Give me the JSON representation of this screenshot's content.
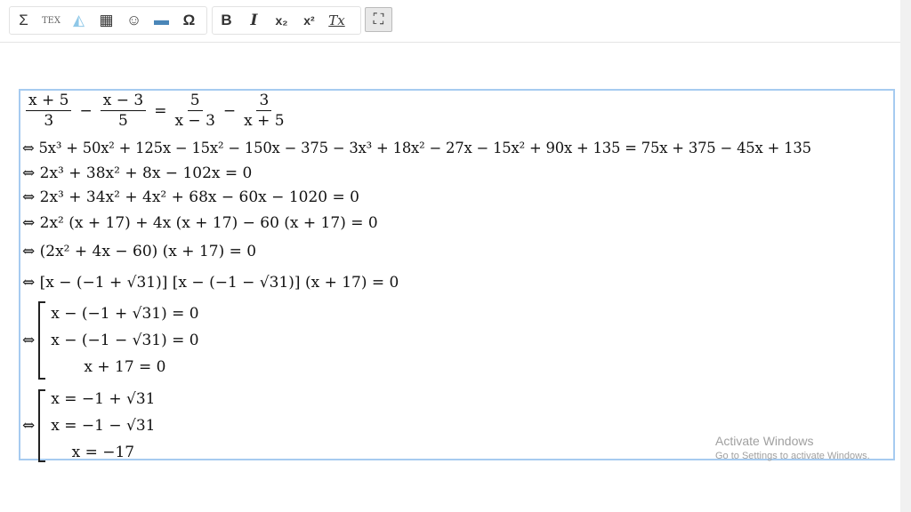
{
  "toolbar": {
    "group1": [
      {
        "name": "sigma-icon",
        "glyph": "Σ"
      },
      {
        "name": "tex-icon",
        "glyph": "TEX"
      },
      {
        "name": "shape-icon",
        "glyph": "◭"
      },
      {
        "name": "table-icon",
        "glyph": "▦"
      },
      {
        "name": "smiley-icon",
        "glyph": "☺"
      },
      {
        "name": "image-icon",
        "glyph": "▬"
      },
      {
        "name": "omega-icon",
        "glyph": "Ω"
      }
    ],
    "group2": [
      {
        "name": "bold-icon",
        "glyph": "B"
      },
      {
        "name": "italic-icon",
        "glyph": "I"
      },
      {
        "name": "subscript-icon",
        "glyph": "x₂"
      },
      {
        "name": "superscript-icon",
        "glyph": "x²"
      },
      {
        "name": "remove-format-icon",
        "glyph": "Tx"
      }
    ],
    "maximize": {
      "name": "maximize-icon",
      "glyph": "⛶",
      "active": true
    }
  },
  "math": {
    "line1": {
      "f1n": "x + 5",
      "f1d": "3",
      "op1": "−",
      "f2n": "x − 3",
      "f2d": "5",
      "eq": "=",
      "f3n": "5",
      "f3d": "x − 3",
      "op2": "−",
      "f4n": "3",
      "f4d": "x + 5"
    },
    "lines": [
      "⇔ 5x³ + 50x² + 125x − 15x² − 150x − 375 − 3x³ + 18x² − 27x − 15x² + 90x + 135 = 75x + 375 − 45x + 135",
      "⇔ 2x³ + 38x² + 8x − 102x = 0",
      "⇔ 2x³ + 34x² + 4x² + 68x − 60x − 1020 = 0",
      "⇔ 2x² (x + 17) + 4x (x + 17) − 60 (x + 17) = 0",
      "⇔ (2x² + 4x − 60) (x + 17) = 0",
      "⇔ [x − (−1 + √31)] [x − (−1 − √31)] (x + 17) = 0"
    ],
    "arrow": "⇔",
    "cases1": [
      "x − (−1 + √31) = 0",
      "x − (−1 − √31) = 0",
      "x + 17 = 0"
    ],
    "cases2": [
      "x = −1 + √31",
      "x = −1 − √31",
      "x = −17"
    ]
  },
  "watermark": {
    "title": "Activate Windows",
    "subtitle": "Go to Settings to activate Windows."
  },
  "colors": {
    "editor_border": "#a6cbf0"
  }
}
